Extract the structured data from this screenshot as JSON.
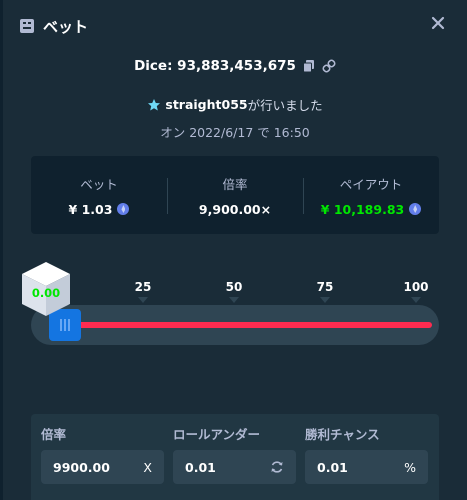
{
  "modal": {
    "title": "ベット",
    "dice_label": "Dice: 93,883,453,675",
    "placed_by_user": "straight055",
    "placed_by_suffix": "が行いました",
    "date_text": "オン 2022/6/17 で 16:50"
  },
  "stats": {
    "bet": {
      "label": "ベット",
      "value": "¥ 1.03"
    },
    "multiplier": {
      "label": "倍率",
      "value": "9,900.00×"
    },
    "payout": {
      "label": "ペイアウト",
      "value": "¥ 10,189.83"
    }
  },
  "slider": {
    "result": "0.00",
    "ticks": [
      "0",
      "25",
      "50",
      "75",
      "100"
    ],
    "roll_under": 0.01,
    "colors": {
      "win": "#00e701",
      "lose": "#ff2b50",
      "thumb": "#1475e1"
    }
  },
  "fields": {
    "multiplier": {
      "label": "倍率",
      "value": "9900.00",
      "suffix": "X"
    },
    "roll_under": {
      "label": "ロールアンダー",
      "value": "0.01"
    },
    "win_chance": {
      "label": "勝利チャンス",
      "value": "0.01",
      "suffix": "%"
    }
  },
  "icons": {
    "header": "bet-ticket-icon",
    "copy": "copy-icon",
    "link": "link-icon",
    "user": "star-user-icon",
    "coin": "ethereum-coin-icon",
    "refresh": "refresh-icon",
    "close": "close-icon"
  }
}
